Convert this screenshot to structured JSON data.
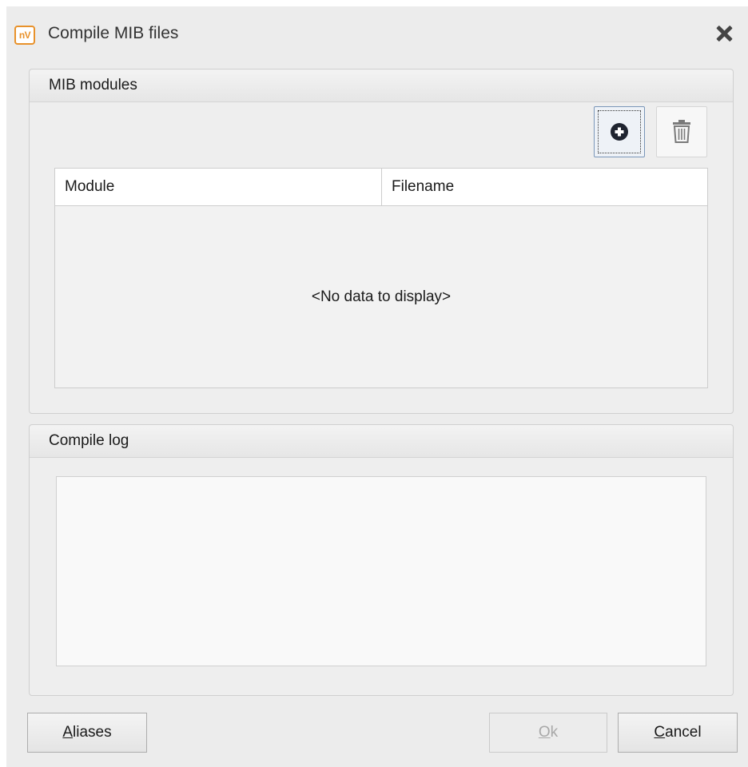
{
  "window": {
    "icon_text": "nV",
    "title": "Compile MIB files"
  },
  "mib_group": {
    "header": "MIB modules",
    "columns": [
      "Module",
      "Filename"
    ],
    "empty_text": "<No data to display>"
  },
  "log_group": {
    "header": "Compile log"
  },
  "buttons": {
    "aliases": {
      "mnemonic": "A",
      "rest": "liases"
    },
    "ok": {
      "mnemonic": "O",
      "rest": "k",
      "enabled": false
    },
    "cancel": {
      "mnemonic": "C",
      "rest": "ancel"
    }
  },
  "icons": {
    "add": "plus-circle-icon",
    "delete": "trash-icon",
    "close": "close-icon"
  }
}
